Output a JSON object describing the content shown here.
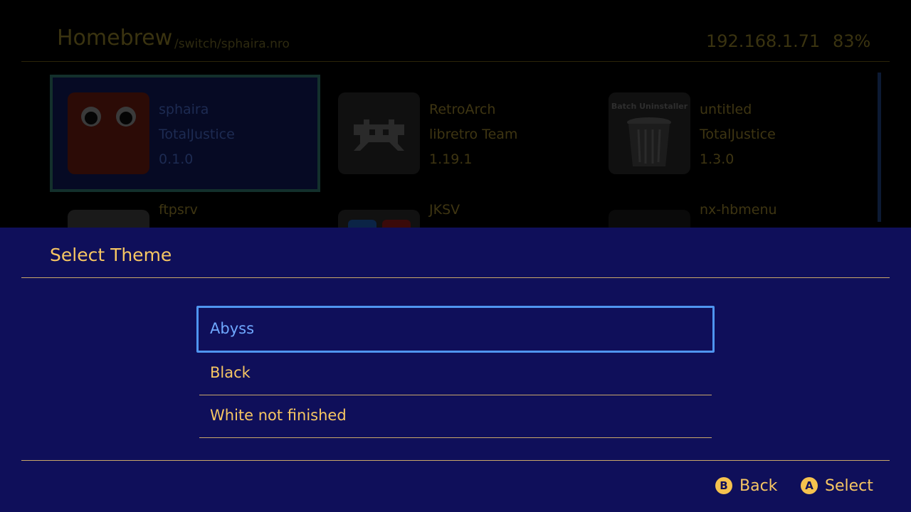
{
  "header": {
    "title": "Homebrew",
    "path": "/switch/sphaira.nro",
    "ip": "192.168.1.71",
    "battery": "83%"
  },
  "apps": [
    {
      "name": "sphaira",
      "author": "TotalJustice",
      "version": "0.1.0",
      "icon": "sphaira-icon",
      "selected": true
    },
    {
      "name": "RetroArch",
      "author": "libretro Team",
      "version": "1.19.1",
      "icon": "retroarch-icon"
    },
    {
      "name": "untitled",
      "author": "TotalJustice",
      "version": "1.3.0",
      "icon": "trash-icon",
      "icon_caption": "Batch Uninstaller"
    },
    {
      "name": "ftpsrv",
      "icon": "ftpsrv-icon"
    },
    {
      "name": "JKSV",
      "icon": "jksv-icon"
    },
    {
      "name": "nx-hbmenu",
      "icon": "hbmenu-icon"
    }
  ],
  "dialog": {
    "title": "Select Theme",
    "options": [
      {
        "label": "Abyss",
        "selected": true
      },
      {
        "label": "Black"
      },
      {
        "label": "White not finished"
      }
    ],
    "hints": [
      {
        "button": "B",
        "label": "Back"
      },
      {
        "button": "A",
        "label": "Select"
      }
    ]
  },
  "colors": {
    "panel": "#0f0f5a",
    "accent_text": "#f6c663",
    "selection": "#4f95f0",
    "background": "#000000"
  }
}
